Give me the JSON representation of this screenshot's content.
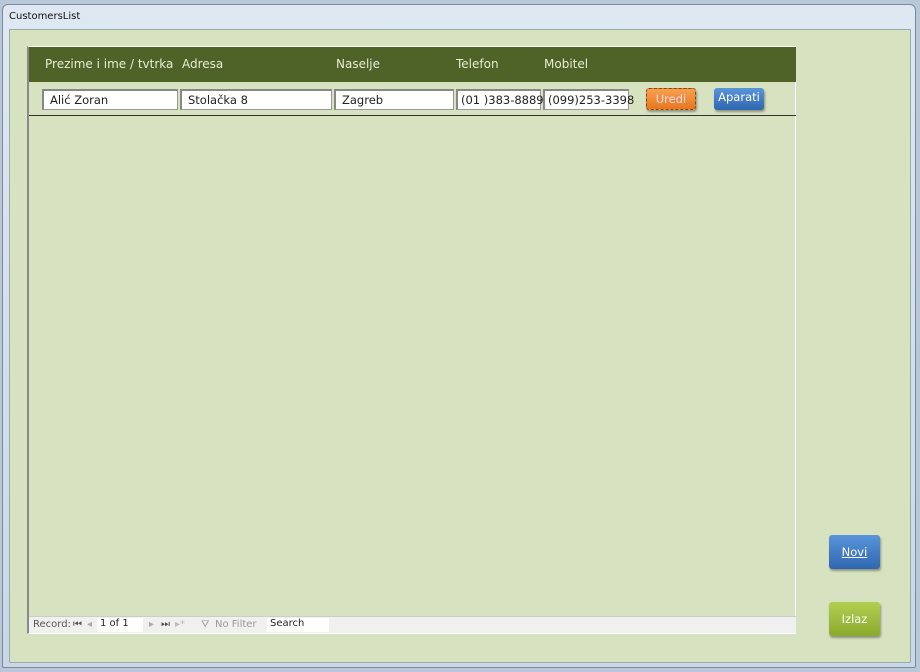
{
  "window": {
    "title": "CustomersList"
  },
  "headers": [
    "Prezime i ime / tvtrka",
    "Adresa",
    "Naselje",
    "Telefon",
    "Mobitel"
  ],
  "record": {
    "name": "Alić Zoran",
    "address": "Stolačka 8",
    "city": "Zagreb",
    "phone": "(01 )383-8889",
    "mobile": "(099)253-3398"
  },
  "buttons": {
    "edit": "Uredi",
    "devices": "Aparati",
    "new": "Novi",
    "exit": "Izlaz"
  },
  "navigator": {
    "label": "Record:",
    "position": "1 of 1",
    "filter": "No Filter",
    "search": "Search"
  },
  "colors": {
    "header": "#4f6228",
    "background": "#d7e2c0",
    "edit": "#f0862a",
    "blue": "#3a78c8",
    "green": "#9bbb3a"
  }
}
